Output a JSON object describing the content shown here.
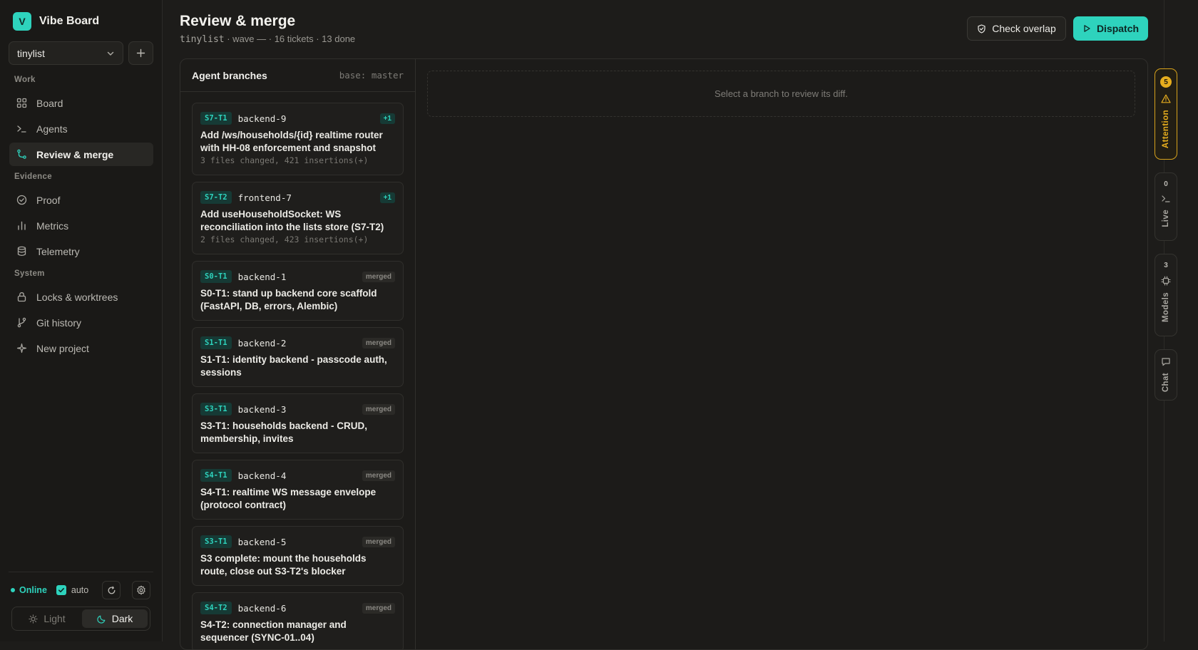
{
  "brand": {
    "logo_letter": "V",
    "name": "Vibe Board"
  },
  "project": {
    "selected": "tinylist",
    "add_icon": "plus-icon"
  },
  "nav": {
    "sections": [
      "Work",
      "Evidence",
      "System"
    ],
    "items": [
      {
        "label": "Board",
        "icon": "grid-icon",
        "active": false
      },
      {
        "label": "Agents",
        "icon": "terminal-icon",
        "active": false
      },
      {
        "label": "Review & merge",
        "icon": "git-merge-icon",
        "active": true
      },
      {
        "label": "Proof",
        "icon": "check-circle-icon",
        "active": false
      },
      {
        "label": "Metrics",
        "icon": "bar-chart-icon",
        "active": false
      },
      {
        "label": "Telemetry",
        "icon": "database-icon",
        "active": false
      },
      {
        "label": "Locks & worktrees",
        "icon": "lock-icon",
        "active": false
      },
      {
        "label": "Git history",
        "icon": "git-branch-icon",
        "active": false
      },
      {
        "label": "New project",
        "icon": "sparkle-icon",
        "active": false
      }
    ]
  },
  "status": {
    "online_label": "Online",
    "auto_label": "auto",
    "auto_checked": true
  },
  "theme": {
    "light_label": "Light",
    "dark_label": "Dark",
    "selected": "Dark"
  },
  "header": {
    "title": "Review & merge",
    "project_mono": "tinylist",
    "subtitle_rest": " · wave — · 16 tickets · 13 done",
    "check_overlap_label": "Check overlap",
    "dispatch_label": "Dispatch"
  },
  "branches_panel": {
    "title": "Agent branches",
    "base": "base: master",
    "branches": [
      {
        "tag": "S7‐T1",
        "name": "backend‐9",
        "badge": "+1",
        "badge_type": "plus",
        "title": "Add /ws/households/{id} realtime router with HH-08 enforcement and snapshot",
        "stats": "3 files changed, 421 insertions(+)"
      },
      {
        "tag": "S7‐T2",
        "name": "frontend‐7",
        "badge": "+1",
        "badge_type": "plus",
        "title": "Add useHouseholdSocket: WS reconciliation into the lists store (S7-T2)",
        "stats": "2 files changed, 423 insertions(+)"
      },
      {
        "tag": "S0‐T1",
        "name": "backend‐1",
        "badge": "merged",
        "badge_type": "merged",
        "title": "S0-T1: stand up backend core scaffold (FastAPI, DB, errors, Alembic)",
        "stats": ""
      },
      {
        "tag": "S1‐T1",
        "name": "backend‐2",
        "badge": "merged",
        "badge_type": "merged",
        "title": "S1-T1: identity backend - passcode auth, sessions",
        "stats": ""
      },
      {
        "tag": "S3‐T1",
        "name": "backend‐3",
        "badge": "merged",
        "badge_type": "merged",
        "title": "S3-T1: households backend - CRUD, membership, invites",
        "stats": ""
      },
      {
        "tag": "S4‐T1",
        "name": "backend‐4",
        "badge": "merged",
        "badge_type": "merged",
        "title": "S4-T1: realtime WS message envelope (protocol contract)",
        "stats": ""
      },
      {
        "tag": "S3‐T1",
        "name": "backend‐5",
        "badge": "merged",
        "badge_type": "merged",
        "title": "S3 complete: mount the households route, close out S3-T2's blocker",
        "stats": ""
      },
      {
        "tag": "S4‐T2",
        "name": "backend‐6",
        "badge": "merged",
        "badge_type": "merged",
        "title": "S4-T2: connection manager and sequencer (SYNC-01..04)",
        "stats": ""
      }
    ]
  },
  "diff": {
    "empty_text": "Select a branch to review its diff."
  },
  "rail": {
    "attention": {
      "count": "5",
      "label": "Attention"
    },
    "live": {
      "count": "0",
      "label": "Live"
    },
    "models": {
      "count": "3",
      "label": "Models"
    },
    "chat": {
      "label": "Chat"
    }
  },
  "colors": {
    "accent": "#2ed3bd",
    "attention": "#e6ad1e",
    "background": "#1d1c1a"
  }
}
